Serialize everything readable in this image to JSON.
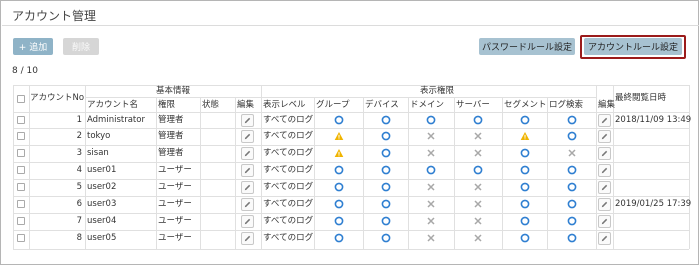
{
  "title": "アカウント管理",
  "toolbar": {
    "add_label": "+ 追加",
    "delete_label": "削除",
    "password_rule_label": "パスワードルール設定",
    "account_rule_label": "アカウントルール設定"
  },
  "count_label": "8 / 10",
  "headers": {
    "group_basic": "基本情報",
    "group_perm": "表示権限",
    "account_no": "アカウントNo",
    "account_name": "アカウント名",
    "role": "権限",
    "status": "状態",
    "edit": "編集",
    "level": "表示レベル",
    "perm_cols": [
      "グループ",
      "デバイス",
      "ドメイン",
      "サーバー",
      "セグメント",
      "ログ検索"
    ],
    "edit2": "編集",
    "last_access": "最終閲覧日時"
  },
  "rows": [
    {
      "no": "1",
      "name": "Administrator",
      "role": "管理者",
      "level": "すべてのログ",
      "perms": [
        "circle",
        "circle",
        "circle",
        "circle",
        "circle",
        "circle"
      ],
      "last": "2018/11/09 13:49"
    },
    {
      "no": "2",
      "name": "tokyo",
      "role": "管理者",
      "level": "すべてのログ",
      "perms": [
        "triangle",
        "circle",
        "cross",
        "cross",
        "triangle",
        "circle"
      ],
      "last": ""
    },
    {
      "no": "3",
      "name": "sisan",
      "role": "管理者",
      "level": "すべてのログ",
      "perms": [
        "triangle",
        "circle",
        "cross",
        "cross",
        "circle",
        "cross"
      ],
      "last": ""
    },
    {
      "no": "4",
      "name": "user01",
      "role": "ユーザー",
      "level": "すべてのログ",
      "perms": [
        "circle",
        "circle",
        "circle",
        "circle",
        "circle",
        "circle"
      ],
      "last": ""
    },
    {
      "no": "5",
      "name": "user02",
      "role": "ユーザー",
      "level": "すべてのログ",
      "perms": [
        "circle",
        "circle",
        "cross",
        "cross",
        "circle",
        "circle"
      ],
      "last": ""
    },
    {
      "no": "6",
      "name": "user03",
      "role": "ユーザー",
      "level": "すべてのログ",
      "perms": [
        "circle",
        "circle",
        "cross",
        "cross",
        "circle",
        "circle"
      ],
      "last": "2019/01/25 17:39"
    },
    {
      "no": "7",
      "name": "user04",
      "role": "ユーザー",
      "level": "すべてのログ",
      "perms": [
        "circle",
        "circle",
        "cross",
        "cross",
        "circle",
        "circle"
      ],
      "last": ""
    },
    {
      "no": "8",
      "name": "user05",
      "role": "ユーザー",
      "level": "すべてのログ",
      "perms": [
        "circle",
        "circle",
        "cross",
        "cross",
        "circle",
        "circle"
      ],
      "last": ""
    }
  ],
  "colors": {
    "circle": "#2f7fd1",
    "triangle": "#f0b400",
    "cross": "#a8a8a8",
    "highlight_border": "#9b1b1b"
  }
}
